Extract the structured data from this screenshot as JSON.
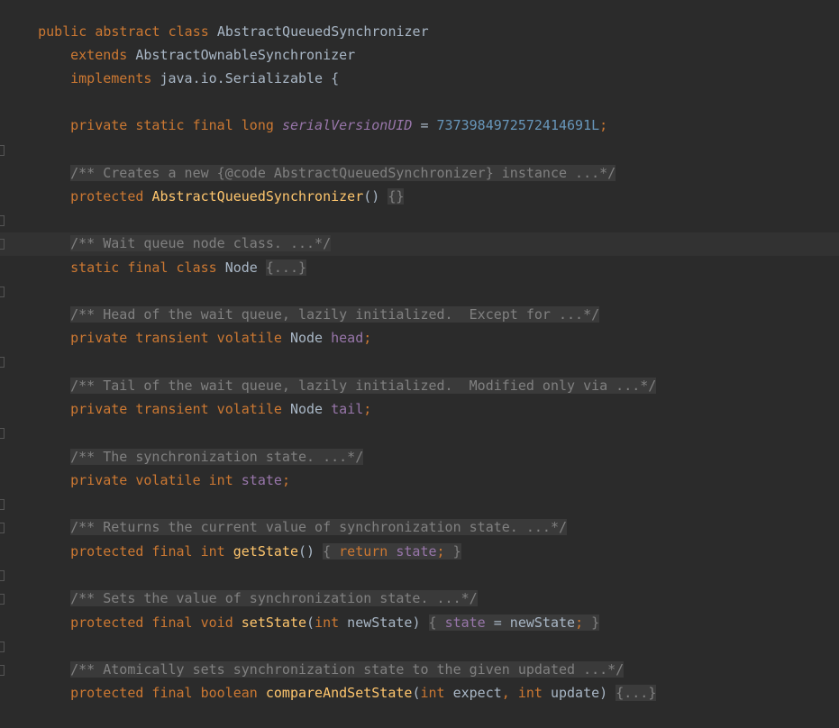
{
  "editor": {
    "theme_colors": {
      "background": "#2b2b2b",
      "keyword": "#cc7832",
      "method": "#ffc66d",
      "field": "#9876aa",
      "number": "#6897bb",
      "comment": "#808080",
      "text": "#a9b7c6"
    },
    "lines": {
      "l1": {
        "kw1": "public",
        "kw2": "abstract",
        "kw3": "class",
        "name": "AbstractQueuedSynchronizer"
      },
      "l2": {
        "kw": "extends",
        "name": "AbstractOwnableSynchronizer"
      },
      "l3": {
        "kw": "implements",
        "name": "java.io.Serializable {"
      },
      "l4": {
        "kw": "private static final long",
        "field": "serialVersionUID",
        "eq": " = ",
        "num": "7373984972572414691L",
        "semi": ";"
      },
      "l5": {
        "comment": "/** Creates a new {@code AbstractQueuedSynchronizer} instance ...*/"
      },
      "l6": {
        "kw": "protected",
        "fn": "AbstractQueuedSynchronizer",
        "parens": "() ",
        "fold": "{}"
      },
      "l7": {
        "comment": "/** Wait queue node class. ...*/"
      },
      "l8": {
        "kw": "static final class",
        "name": "Node",
        "fold": "{...}"
      },
      "l9": {
        "comment": "/** Head of the wait queue, lazily initialized.  Except for ...*/"
      },
      "l10": {
        "kw": "private transient volatile",
        "type": "Node",
        "field": "head",
        "semi": ";"
      },
      "l11": {
        "comment": "/** Tail of the wait queue, lazily initialized.  Modified only via ...*/"
      },
      "l12": {
        "kw": "private transient volatile",
        "type": "Node",
        "field": "tail",
        "semi": ";"
      },
      "l13": {
        "comment": "/** The synchronization state. ...*/"
      },
      "l14": {
        "kw": "private volatile int",
        "field": "state",
        "semi": ";"
      },
      "l15": {
        "comment": "/** Returns the current value of synchronization state. ...*/"
      },
      "l16": {
        "kw": "protected final int",
        "fn": "getState",
        "parens": "() ",
        "open": "{ ",
        "ret": "return",
        "field": "state",
        "semi": ";",
        "close": " }"
      },
      "l17": {
        "comment": "/** Sets the value of synchronization state. ...*/"
      },
      "l18": {
        "kw": "protected final void",
        "fn": "setState",
        "lp": "(",
        "ptype": "int",
        "pname": " newState",
        "rp": ") ",
        "open": "{ ",
        "field": "state",
        "assign": " = newState",
        "semi": ";",
        "close": " }"
      },
      "l19": {
        "comment": "/** Atomically sets synchronization state to the given updated ...*/"
      },
      "l20": {
        "kw": "protected final boolean",
        "fn": "compareAndSetState",
        "lp": "(",
        "t1": "int",
        "p1": " expect",
        "comma": ", ",
        "t2": "int",
        "p2": " update",
        "rp": ") ",
        "fold": "{...}"
      }
    }
  }
}
